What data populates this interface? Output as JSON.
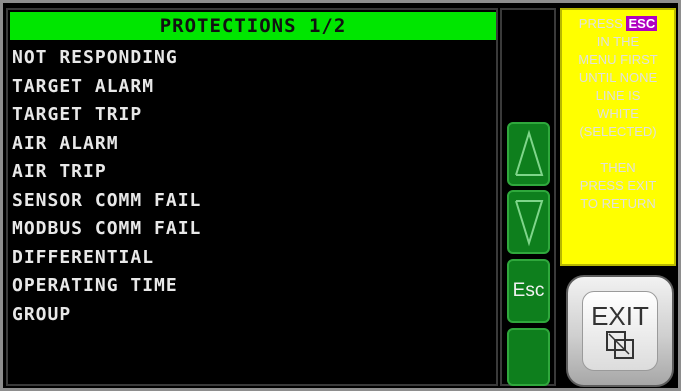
{
  "title": "PROTECTIONS 1/2",
  "items": [
    "NOT RESPONDING",
    "TARGET ALARM",
    "TARGET TRIP",
    "AIR ALARM",
    "AIR TRIP",
    "SENSOR COMM FAIL",
    "MODBUS COMM FAIL",
    "DIFFERENTIAL",
    "OPERATING TIME",
    "GROUP"
  ],
  "nav": {
    "up_icon": "arrow-up-icon",
    "down_icon": "arrow-down-icon",
    "esc_label": "Esc",
    "blank_icon": "blank"
  },
  "info": {
    "line1_prefix": "PRESS",
    "line1_tag": "ESC",
    "lines": [
      "IN THE",
      "MENU FIRST",
      "UNTIL NONE",
      "LINE IS",
      "WHITE",
      "(SELECTED)"
    ],
    "lines2": [
      "THEN",
      "PRESS EXIT",
      "TO RETURN"
    ]
  },
  "exit": {
    "label": "EXIT",
    "icon": "exit-squares-icon"
  },
  "colors": {
    "title_bg": "#00e600",
    "button_green": "#0e7f1d",
    "info_bg": "#ffff00",
    "esc_tag": "#b000c0"
  }
}
